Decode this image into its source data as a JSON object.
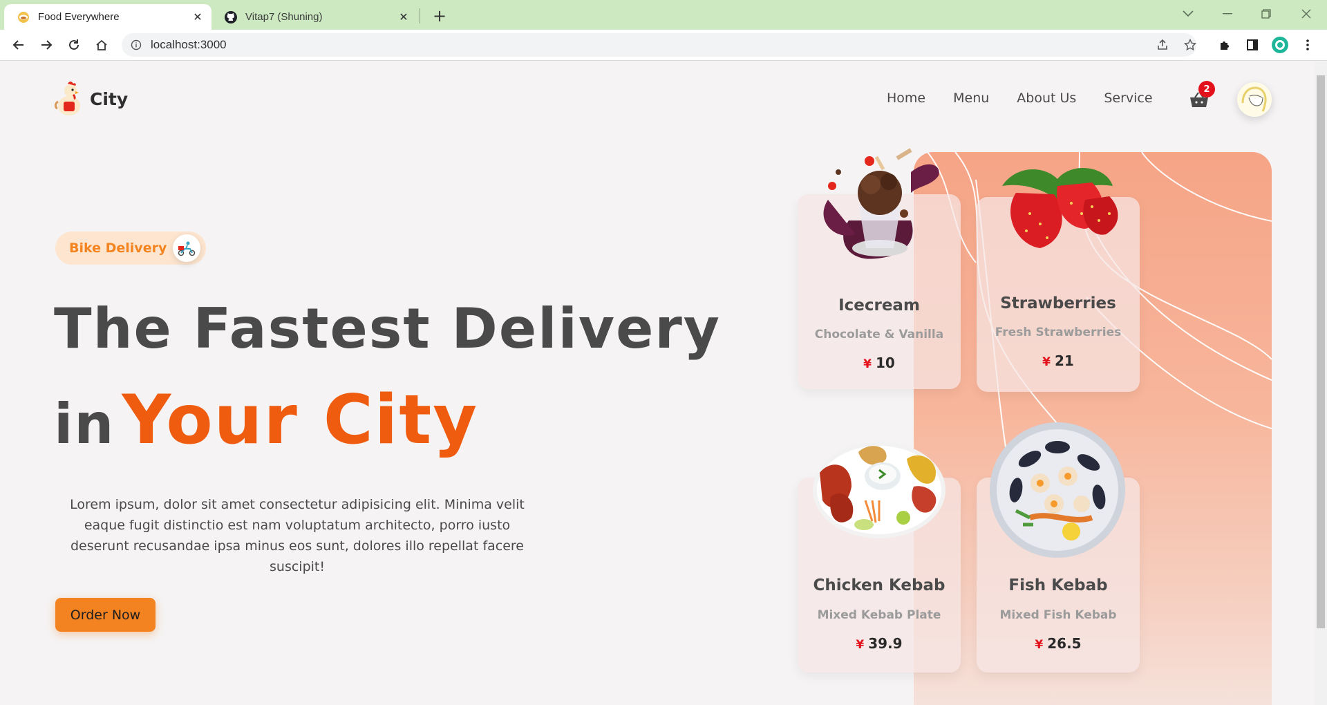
{
  "browser": {
    "tabs": [
      {
        "title": "Food Everywhere",
        "favicon": "food-favicon",
        "active": true
      },
      {
        "title": "Vitap7 (Shuning)",
        "favicon": "github-favicon",
        "active": false
      }
    ],
    "url": "localhost:3000"
  },
  "site": {
    "brand": "City",
    "nav": [
      "Home",
      "Menu",
      "About Us",
      "Service"
    ],
    "cart_count": "2"
  },
  "hero": {
    "pill_label": "Bike Delivery",
    "headline_line1": "The Fastest Delivery",
    "headline_in": "in",
    "headline_accent": "Your City",
    "lead": "Lorem ipsum, dolor sit amet consectetur adipisicing elit. Minima velit eaque fugit distinctio est nam voluptatum architecto, porro iusto deserunt recusandae ipsa minus eos sunt, dolores illo repellat facere suscipit!",
    "cta": "Order Now",
    "accent_color": "#ef5c0f",
    "button_color": "#f38221"
  },
  "cards": [
    {
      "title": "Icecream",
      "subtitle": "Chocolate & Vanilla",
      "currency": "¥",
      "price": "10",
      "image": "icecream-image"
    },
    {
      "title": "Strawberries",
      "subtitle": "Fresh Strawberries",
      "currency": "¥",
      "price": "21",
      "image": "strawberries-image"
    },
    {
      "title": "Chicken Kebab",
      "subtitle": "Mixed Kebab Plate",
      "currency": "¥",
      "price": "39.9",
      "image": "chicken-kebab-image"
    },
    {
      "title": "Fish Kebab",
      "subtitle": "Mixed Fish Kebab",
      "currency": "¥",
      "price": "26.5",
      "image": "fish-kebab-image"
    }
  ]
}
